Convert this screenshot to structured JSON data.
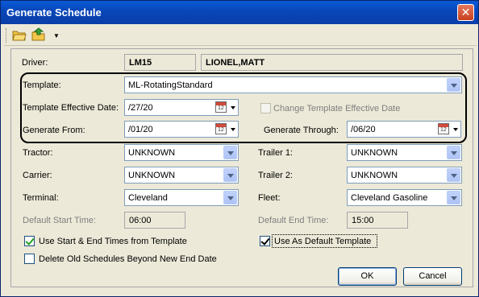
{
  "window": {
    "title": "Generate Schedule",
    "close_glyph": "✕"
  },
  "toolbar": {
    "icons": [
      "open-folder-icon",
      "export-icon",
      "dropdown-arrow-icon"
    ],
    "dropdown_glyph": "▼"
  },
  "form": {
    "driver": {
      "label": "Driver:",
      "code": "LM15",
      "name": "LIONEL,MATT"
    },
    "template": {
      "label": "Template:",
      "value": "ML-RotatingStandard"
    },
    "template_effective_date": {
      "label": "Template Effective Date:",
      "value": "/27/20"
    },
    "change_effective_date": {
      "label": "Change Template Effective Date",
      "checked": false,
      "enabled": false
    },
    "generate_from": {
      "label": "Generate From:",
      "value": "/01/20"
    },
    "generate_through": {
      "label": "Generate Through:",
      "value": "/06/20"
    },
    "tractor": {
      "label": "Tractor:",
      "value": "UNKNOWN"
    },
    "trailer1": {
      "label": "Trailer 1:",
      "value": "UNKNOWN"
    },
    "carrier": {
      "label": "Carrier:",
      "value": "UNKNOWN"
    },
    "trailer2": {
      "label": "Trailer 2:",
      "value": "UNKNOWN"
    },
    "terminal": {
      "label": "Terminal:",
      "value": "Cleveland"
    },
    "fleet": {
      "label": "Fleet:",
      "value": "Cleveland Gasoline"
    },
    "default_start_time": {
      "label": "Default Start Time:",
      "value": "06:00"
    },
    "default_end_time": {
      "label": "Default End Time:",
      "value": "15:00"
    },
    "use_template_times": {
      "label": "Use Start & End Times from Template",
      "checked": true
    },
    "use_default_template": {
      "label": "Use As Default Template",
      "checked": true
    },
    "delete_old": {
      "label": "Delete Old Schedules Beyond New End Date",
      "checked": false
    }
  },
  "buttons": {
    "ok": "OK",
    "cancel": "Cancel"
  },
  "colors": {
    "titlebar": "#0a46b8",
    "dialog_bg": "#ece9d8",
    "annotation_outline": "#000000"
  }
}
